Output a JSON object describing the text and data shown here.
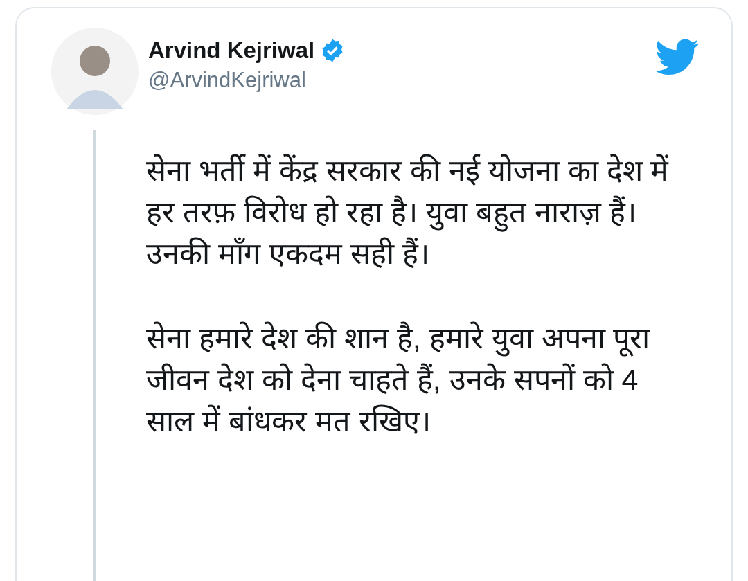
{
  "tweet": {
    "author": {
      "name": "Arvind Kejriwal",
      "verified": true,
      "handle": "@ArvindKejriwal"
    },
    "paragraphs": [
      "सेना भर्ती में केंद्र सरकार की नई योजना का देश में हर तरफ़ विरोध हो रहा है। युवा बहुत नाराज़ हैं। उनकी माँग एकदम सही हैं।",
      "सेना हमारे देश की शान है, हमारे युवा अपना पूरा जीवन देश को देना चाहते हैं, उनके सपनों को 4 साल में बांधकर मत रखिए।"
    ]
  }
}
